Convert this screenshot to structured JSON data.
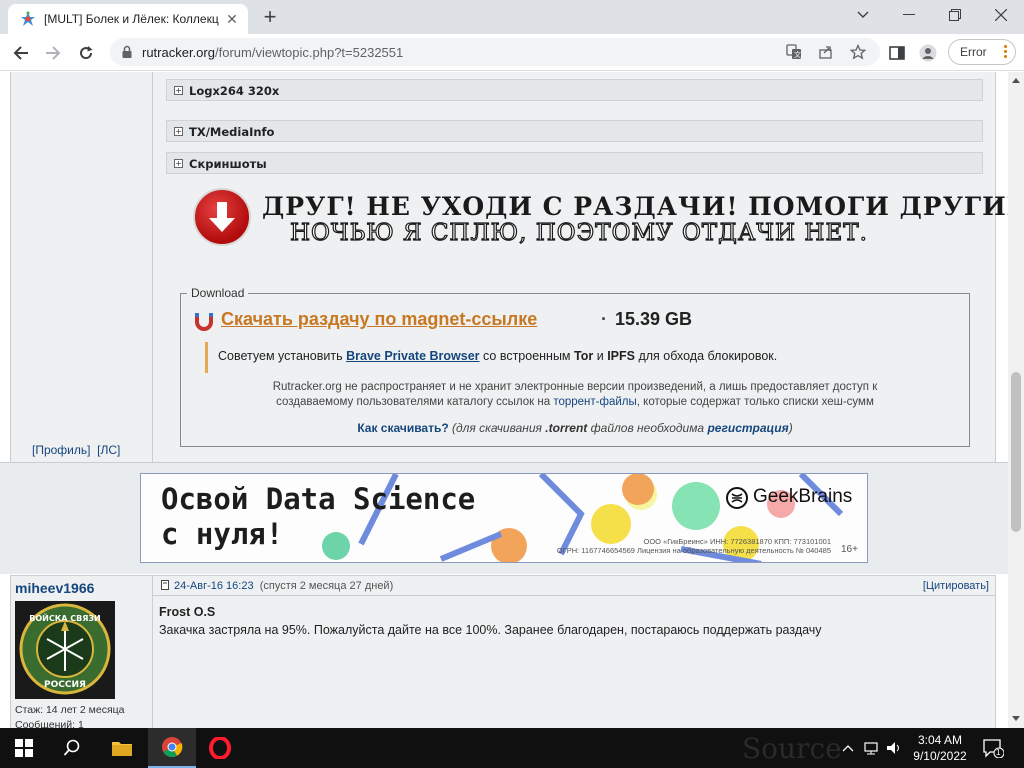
{
  "browser": {
    "tab_title": "[MULT] Болек и Лёлек: Коллекц",
    "url_host": "rutracker.org",
    "url_path": "/forum/viewtopic.php?t=5232551",
    "error_label": "Error"
  },
  "spoilers": [
    {
      "label": "Logx264 320x"
    },
    {
      "label": "TX/MediaInfo"
    },
    {
      "label": "Скриншоты"
    }
  ],
  "banner": {
    "line1": "ДРУГ! НЕ УХОДИ С РАЗДАЧИ! ПОМОГИ ДРУГИМ!",
    "line2": "НОЧЬЮ Я СПЛЮ, ПОЭТОМУ ОТДАЧИ НЕТ."
  },
  "download": {
    "legend": "Download",
    "magnet_link": "Скачать раздачу по magnet-ссылке",
    "dot": "·",
    "size": "15.39 GB",
    "advice_prefix": "Советуем установить",
    "advice_browser": "Brave Private Browser",
    "advice_mid": "со встроенным",
    "advice_tor": "Tor",
    "advice_and": "и",
    "advice_ipfs": "IPFS",
    "advice_suffix": "для обхода блокировок.",
    "disclaimer_1": "Rutracker.org не распространяет и не хранит электронные версии произведений, а лишь предоставляет доступ к",
    "disclaimer_2a": "создаваемому пользователями каталогу ссылок на",
    "disclaimer_link": "торрент-файлы",
    "disclaimer_2b": ", которые содержат только списки хеш-сумм",
    "howto_link": "Как скачивать?",
    "howto_1": "(для скачивания",
    "howto_torrent": ".torrent",
    "howto_2": "файлов необходима",
    "howto_reg": "регистрация",
    "howto_3": ")"
  },
  "profile_links": "[Профиль]  [ЛС]",
  "ad": {
    "headline": "Освой Data Science\nс нуля!",
    "brand": "GeekBrains",
    "legal_1": "ООО «ГикБреинс» ИНН: 7726381870 КПП: 773101001",
    "legal_2": "ОГРН: 1167746654569 Лицензия на образовательную деятельность № 040485",
    "age": "16+"
  },
  "post": {
    "nick": "miheev1966",
    "avatar_text_top": "ВОЙСКА СВЯЗИ",
    "avatar_text_bottom": "РОССИЯ",
    "stat_stage": "Стаж: 14 лет 2 месяца",
    "stat_messages": "Сообщений: 1",
    "date": "24-Авг-16 16:23",
    "date_rel": "(спустя 2 месяца 27 дней)",
    "quote": "[Цитировать]",
    "author_line": "Frost O.S",
    "body": "Закачка застряла на 95%. Пожалуйста дайте на все 100%. Заранее благодарен, постараюсь поддержать раздачу"
  },
  "taskbar": {
    "time": "3:04 AM",
    "date": "9/10/2022",
    "notifications": "1",
    "watermark": "Source"
  },
  "colors": {
    "link": "#15467d",
    "magnet": "#c87822",
    "post_bg": "#eef0f2"
  }
}
